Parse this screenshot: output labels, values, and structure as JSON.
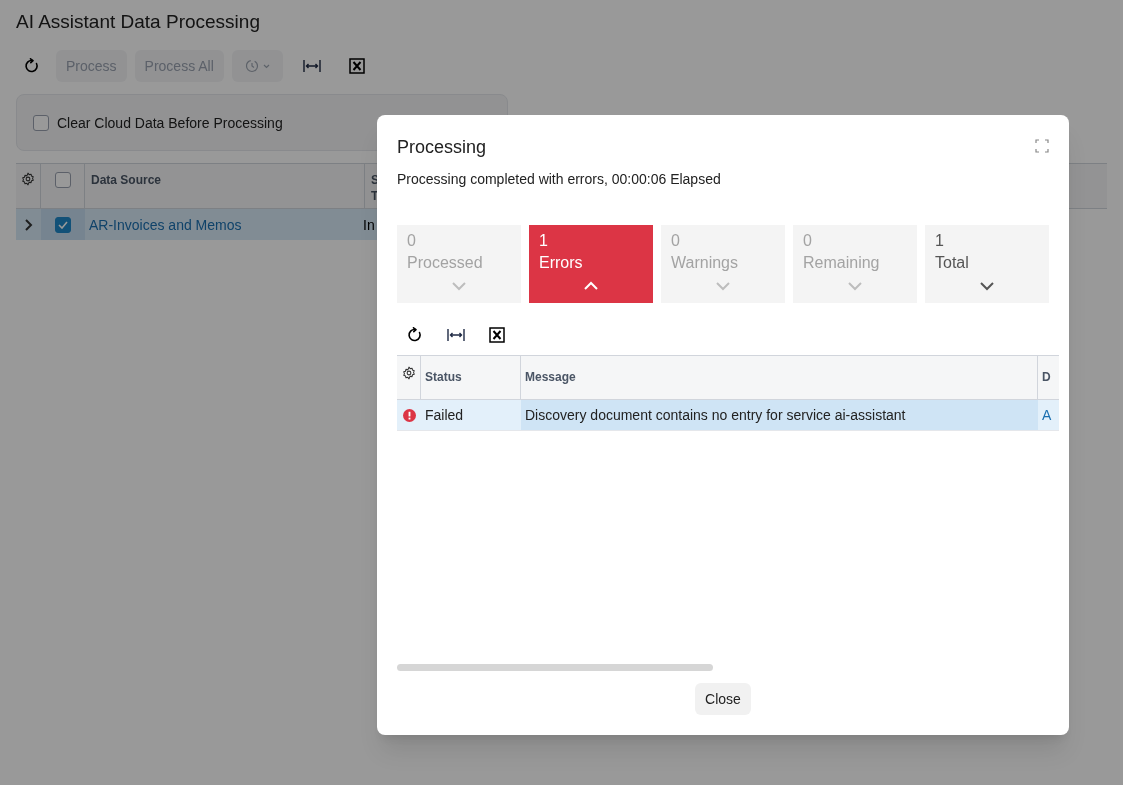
{
  "page": {
    "title": "AI Assistant Data Processing",
    "toolbar": [
      {
        "kind": "refresh"
      },
      {
        "kind": "button",
        "label": "Process",
        "disabled": true
      },
      {
        "kind": "button",
        "label": "Process All",
        "disabled": true
      },
      {
        "kind": "history",
        "disabled": true
      },
      {
        "kind": "fit"
      },
      {
        "kind": "excel"
      }
    ],
    "options": {
      "label": "Clear Cloud Data Before Processing",
      "checked": false
    },
    "table": {
      "select_all_checked": false,
      "columns": [
        {
          "lines": [
            "Data Source"
          ]
        },
        {
          "lines": [
            "S",
            "T"
          ]
        }
      ],
      "rows": [
        {
          "expanded": false,
          "selected": true,
          "cells": [
            "AR-Invoices and Memos",
            "In"
          ]
        }
      ]
    }
  },
  "dialog": {
    "title": "Processing",
    "status": "Processing completed with errors, 00:00:06 Elapsed",
    "tiles": [
      {
        "count": "0",
        "label": "Processed",
        "selected": false,
        "dimmed": true
      },
      {
        "count": "1",
        "label": "Errors",
        "selected": true,
        "dimmed": false
      },
      {
        "count": "0",
        "label": "Warnings",
        "selected": false,
        "dimmed": true
      },
      {
        "count": "0",
        "label": "Remaining",
        "selected": false,
        "dimmed": true
      },
      {
        "count": "1",
        "label": "Total",
        "selected": false,
        "dimmed": false
      }
    ],
    "toolbar": [
      {
        "kind": "refresh"
      },
      {
        "kind": "fit"
      },
      {
        "kind": "excel"
      }
    ],
    "table": {
      "columns": [
        "Status",
        "Message",
        "D"
      ],
      "rows": [
        {
          "kind": "error",
          "status": "Failed",
          "message": "Discovery document contains no entry for service ai-assistant",
          "column_3": "A"
        }
      ]
    },
    "buttons": [
      "Close"
    ]
  }
}
